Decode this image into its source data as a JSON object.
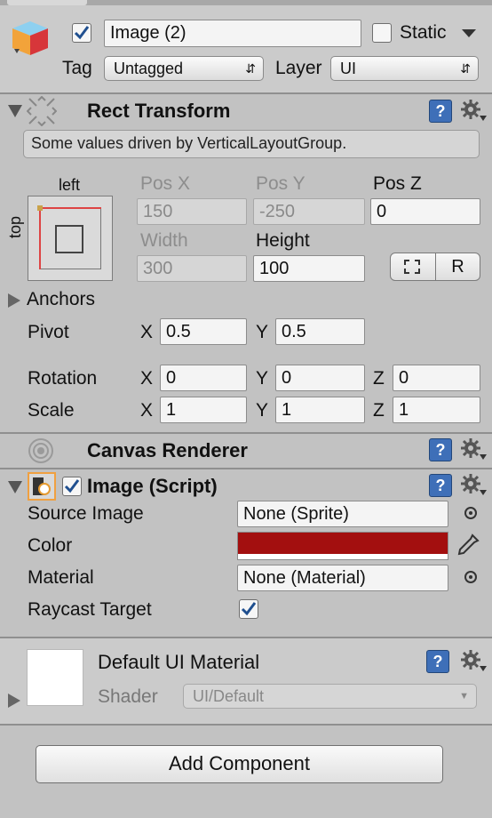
{
  "header": {
    "object_name": "Image (2)",
    "active_checked": true,
    "static_label": "Static",
    "static_checked": false,
    "tag_label": "Tag",
    "tag_value": "Untagged",
    "layer_label": "Layer",
    "layer_value": "UI"
  },
  "rect_transform": {
    "title": "Rect Transform",
    "info": "Some values driven by VerticalLayoutGroup.",
    "anchor_h_label": "left",
    "anchor_v_label": "top",
    "pos_x_label": "Pos X",
    "pos_x": "150",
    "pos_y_label": "Pos Y",
    "pos_y": "-250",
    "pos_z_label": "Pos Z",
    "pos_z": "0",
    "width_label": "Width",
    "width": "300",
    "height_label": "Height",
    "height": "100",
    "r_button": "R",
    "anchors_label": "Anchors",
    "pivot_label": "Pivot",
    "pivot_x": "0.5",
    "pivot_y": "0.5",
    "rotation_label": "Rotation",
    "rot_x": "0",
    "rot_y": "0",
    "rot_z": "0",
    "scale_label": "Scale",
    "scale_x": "1",
    "scale_y": "1",
    "scale_z": "1",
    "x_letter": "X",
    "y_letter": "Y",
    "z_letter": "Z"
  },
  "canvas_renderer": {
    "title": "Canvas Renderer"
  },
  "image_script": {
    "title": "Image (Script)",
    "enabled": true,
    "source_image_label": "Source Image",
    "source_image_value": "None (Sprite)",
    "color_label": "Color",
    "color_value": "#a30f0f",
    "material_label": "Material",
    "material_value": "None (Material)",
    "raycast_label": "Raycast Target",
    "raycast_checked": true
  },
  "material_section": {
    "title": "Default UI Material",
    "shader_label": "Shader",
    "shader_value": "UI/Default"
  },
  "add_component_label": "Add Component",
  "colors": {
    "accent_blue": "#3e6fb8",
    "selected_outline": "#f0a040",
    "panel_bg": "#c2c2c2"
  }
}
